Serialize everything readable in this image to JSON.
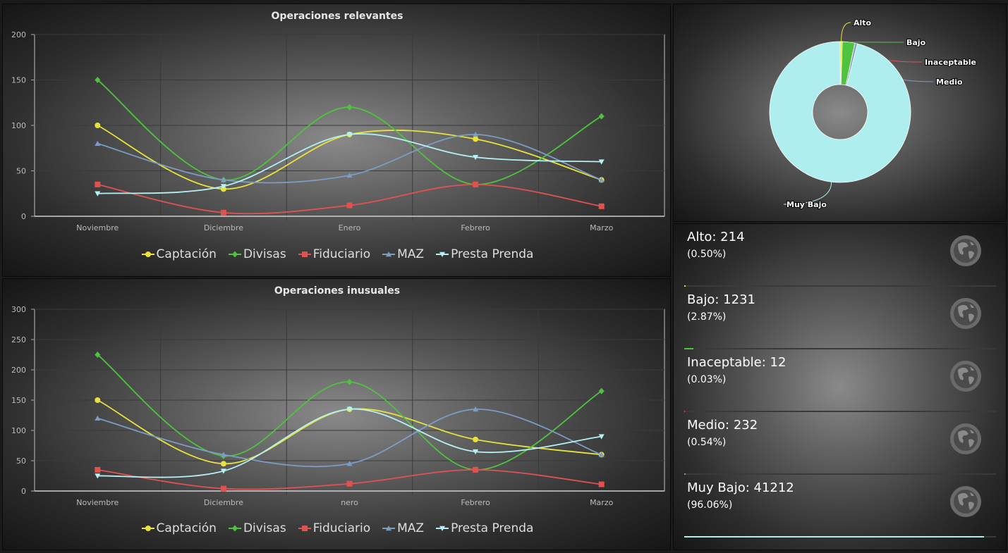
{
  "series_meta": [
    {
      "name": "Captación",
      "color": "#e8e33a",
      "marker": "circle"
    },
    {
      "name": "Divisas",
      "color": "#4fc23f",
      "marker": "diamond"
    },
    {
      "name": "Fiduciario",
      "color": "#e05252",
      "marker": "square"
    },
    {
      "name": "MAZ",
      "color": "#7c9cc4",
      "marker": "triangle"
    },
    {
      "name": "Presta Prenda",
      "color": "#b5f1f5",
      "marker": "triangle-down"
    }
  ],
  "chart_data": [
    {
      "type": "line",
      "title": "Operaciones relevantes",
      "categories": [
        "Noviembre",
        "Diciembre",
        "Enero",
        "Febrero",
        "Marzo"
      ],
      "ylim": [
        0,
        200
      ],
      "yticks": [
        0,
        50,
        100,
        150,
        200
      ],
      "grid": true,
      "legend": "bottom",
      "series": [
        {
          "name": "Captación",
          "values": [
            100,
            30,
            90,
            85,
            40
          ]
        },
        {
          "name": "Divisas",
          "values": [
            150,
            40,
            120,
            35,
            110
          ]
        },
        {
          "name": "Fiduciario",
          "values": [
            35,
            4,
            12,
            35,
            11
          ]
        },
        {
          "name": "MAZ",
          "values": [
            80,
            40,
            45,
            90,
            40
          ]
        },
        {
          "name": "Presta Prenda",
          "values": [
            25,
            33,
            90,
            65,
            60
          ]
        }
      ]
    },
    {
      "type": "line",
      "title": "Operaciones inusuales",
      "categories": [
        "Noviembre",
        "Diciembre",
        "nero",
        "Febrero",
        "Marzo"
      ],
      "ylim": [
        0,
        300
      ],
      "yticks": [
        0,
        50,
        100,
        150,
        200,
        250,
        300
      ],
      "grid": true,
      "legend": "bottom",
      "series": [
        {
          "name": "Captación",
          "values": [
            150,
            45,
            135,
            85,
            60
          ]
        },
        {
          "name": "Divisas",
          "values": [
            225,
            58,
            180,
            35,
            165
          ]
        },
        {
          "name": "Fiduciario",
          "values": [
            35,
            4,
            12,
            35,
            11
          ]
        },
        {
          "name": "MAZ",
          "values": [
            120,
            60,
            45,
            135,
            60
          ]
        },
        {
          "name": "Presta Prenda",
          "values": [
            25,
            33,
            135,
            65,
            90
          ]
        }
      ]
    },
    {
      "type": "pie",
      "donut": true,
      "slices": [
        {
          "label": "Alto",
          "value": 214,
          "color": "#e8e33a"
        },
        {
          "label": "Bajo",
          "value": 1231,
          "color": "#4fc23f"
        },
        {
          "label": "Inaceptable",
          "value": 12,
          "color": "#e05252"
        },
        {
          "label": "Medio",
          "value": 232,
          "color": "#7c9cc4"
        },
        {
          "label": "Muy Bajo",
          "value": 41212,
          "color": "#aeeeee"
        }
      ]
    }
  ],
  "summary": [
    {
      "title": "Alto: 214",
      "pct_label": "(0.50%)",
      "fraction": 0.005,
      "color": "#e8e33a"
    },
    {
      "title": "Bajo: 1231",
      "pct_label": "(2.87%)",
      "fraction": 0.0287,
      "color": "#4fc23f"
    },
    {
      "title": "Inaceptable: 12",
      "pct_label": "(0.03%)",
      "fraction": 0.0003,
      "color": "#e05252"
    },
    {
      "title": "Medio: 232",
      "pct_label": "(0.54%)",
      "fraction": 0.0054,
      "color": "#7c9cc4"
    },
    {
      "title": "Muy Bajo: 41212",
      "pct_label": "(96.06%)",
      "fraction": 0.9606,
      "color": "#aeeeee"
    }
  ],
  "icons": {
    "summary_icon": "globe-icon"
  }
}
